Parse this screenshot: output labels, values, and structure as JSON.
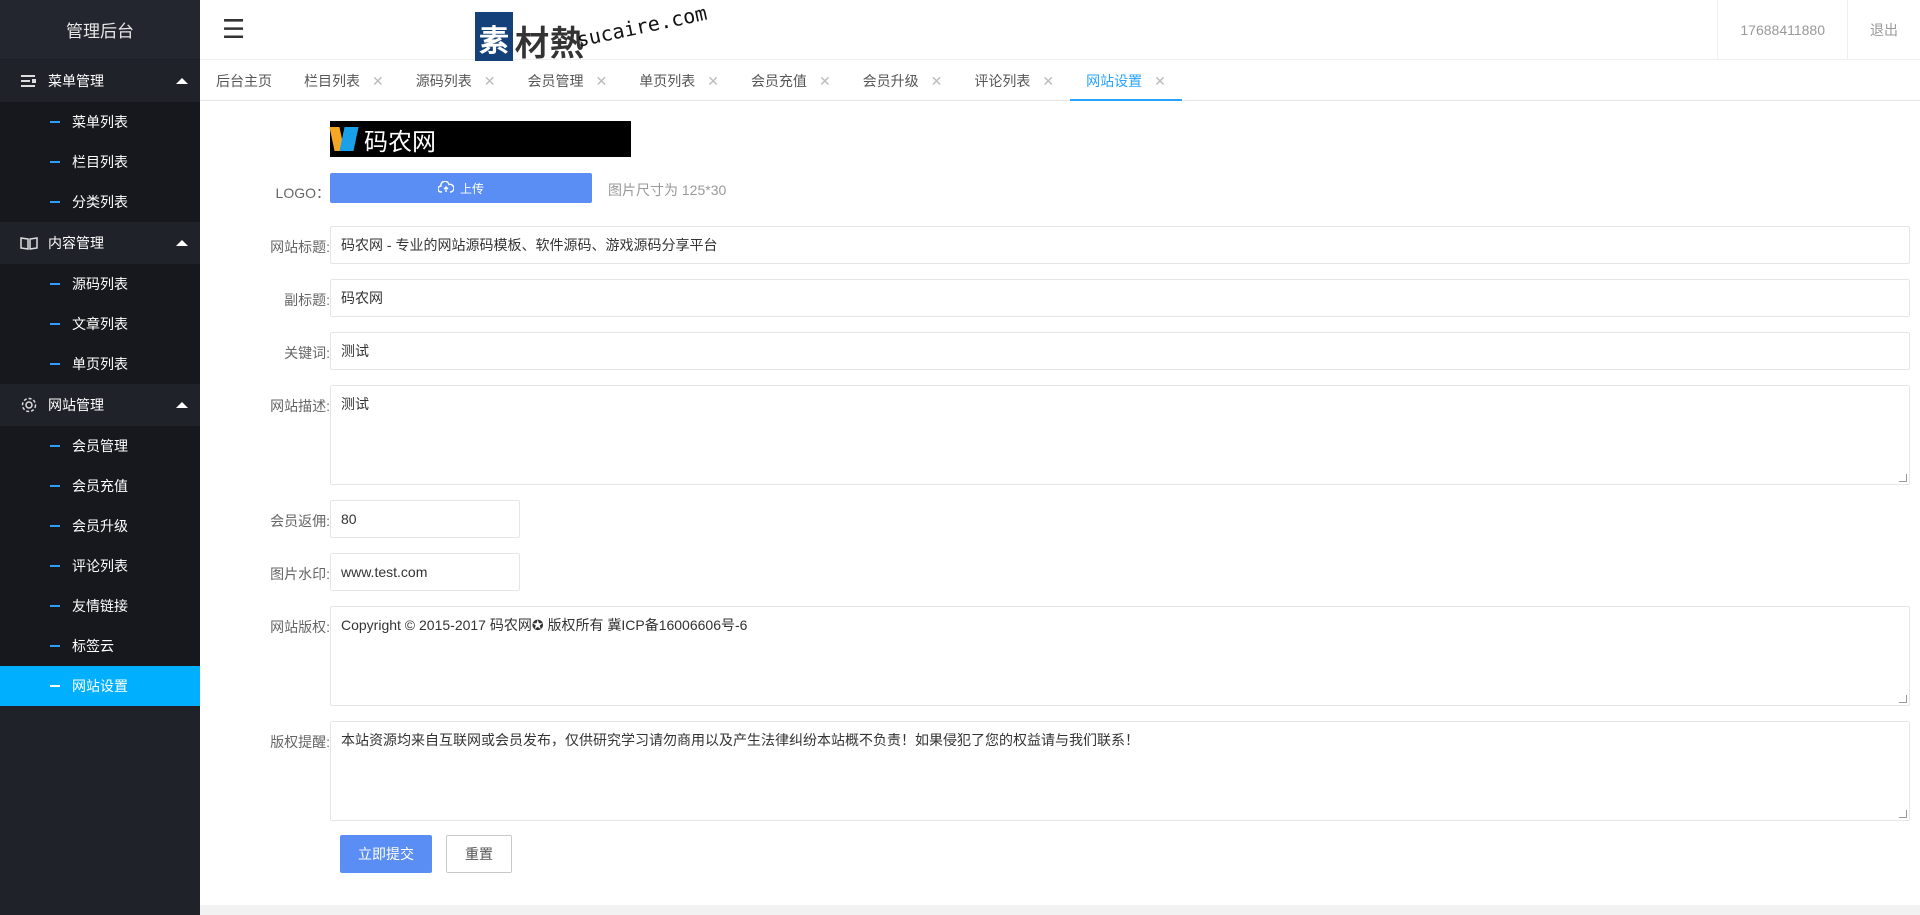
{
  "sidebar": {
    "brand": "管理后台",
    "groups": [
      {
        "label": "菜单管理",
        "icon": "menu-list-icon",
        "items": [
          {
            "label": "菜单列表"
          },
          {
            "label": "栏目列表"
          },
          {
            "label": "分类列表"
          }
        ]
      },
      {
        "label": "内容管理",
        "icon": "book-icon",
        "items": [
          {
            "label": "源码列表"
          },
          {
            "label": "文章列表"
          },
          {
            "label": "单页列表"
          }
        ]
      },
      {
        "label": "网站管理",
        "icon": "gear-icon",
        "items": [
          {
            "label": "会员管理"
          },
          {
            "label": "会员充值"
          },
          {
            "label": "会员升级"
          },
          {
            "label": "评论列表"
          },
          {
            "label": "友情链接"
          },
          {
            "label": "标签云"
          },
          {
            "label": "网站设置",
            "active": true
          }
        ]
      }
    ]
  },
  "header": {
    "watermark_zh": "素材熱",
    "watermark_box": "素",
    "watermark_en": "sucaire.com",
    "user": "17688411880",
    "logout": "退出"
  },
  "tabs": [
    {
      "label": "后台主页",
      "closable": false
    },
    {
      "label": "栏目列表",
      "closable": true
    },
    {
      "label": "源码列表",
      "closable": true
    },
    {
      "label": "会员管理",
      "closable": true
    },
    {
      "label": "单页列表",
      "closable": true
    },
    {
      "label": "会员充值",
      "closable": true
    },
    {
      "label": "会员升级",
      "closable": true
    },
    {
      "label": "评论列表",
      "closable": true
    },
    {
      "label": "网站设置",
      "closable": true,
      "active": true
    }
  ],
  "tab_close_glyph": "✕",
  "form": {
    "logo_text": "码农网",
    "logo_label": "LOGO：",
    "upload_label": "上传",
    "upload_hint": "图片尺寸为 125*30",
    "title_label": "网站标题:",
    "title_value": "码农网 - 专业的网站源码模板、软件源码、游戏源码分享平台",
    "subtitle_label": "副标题:",
    "subtitle_value": "码农网",
    "keywords_label": "关键词:",
    "keywords_value": "测试",
    "desc_label": "网站描述:",
    "desc_value": "测试",
    "rebate_label": "会员返佣:",
    "rebate_value": "80",
    "watermark_label": "图片水印:",
    "watermark_value": "www.test.com",
    "copyright_label": "网站版权:",
    "copyright_value": "Copyright © 2015-2017 码农网✪ 版权所有 冀ICP备16006606号-6",
    "notice_label": "版权提醒:",
    "notice_value": "本站资源均来自互联网或会员发布，仅供研究学习请勿商用以及产生法律纠纷本站概不负责！如果侵犯了您的权益请与我们联系！",
    "submit_label": "立即提交",
    "reset_label": "重置"
  },
  "colors": {
    "accent": "#00b0ff",
    "primary_button": "#5b8ef5",
    "sidebar_bg": "#20222a",
    "tab_active": "#29a3ff"
  }
}
